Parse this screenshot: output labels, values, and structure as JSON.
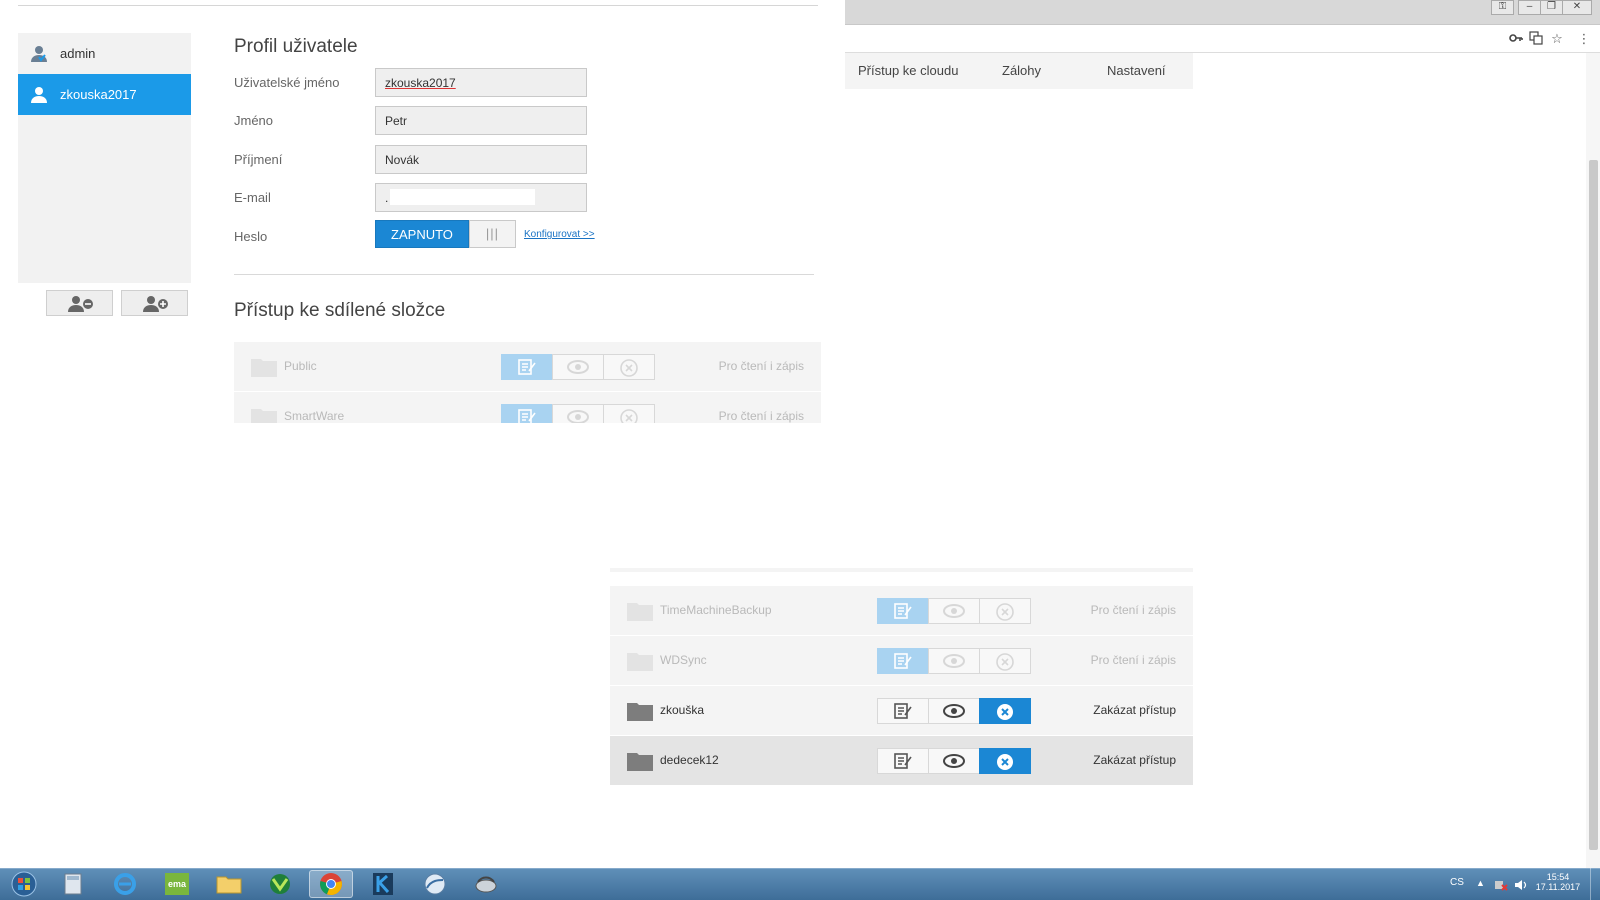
{
  "window": {
    "controls": [
      "lock",
      "minimize",
      "restore",
      "close"
    ]
  },
  "toolbar_icons": [
    "key-icon",
    "translate-icon",
    "star-icon",
    "menu-icon"
  ],
  "nav": {
    "tabs": [
      "Přístup ke cloudu",
      "Zálohy",
      "Nastavení"
    ]
  },
  "users": {
    "items": [
      {
        "name": "admin",
        "selected": false,
        "icon": "admin-user-icon"
      },
      {
        "name": "zkouska2017",
        "selected": true,
        "icon": "user-icon"
      }
    ],
    "remove_icon": "remove-user-icon",
    "add_icon": "add-user-icon"
  },
  "profile": {
    "title": "Profil uživatele",
    "username_label": "Uživatelské jméno",
    "username_value": "zkouska2017",
    "firstname_label": "Jméno",
    "firstname_value": "Petr",
    "lastname_label": "Příjmení",
    "lastname_value": "Novák",
    "email_label": "E-mail",
    "email_value": ".",
    "password_label": "Heslo",
    "password_toggle": "ZAPNUTO",
    "configure_link": "Konfigurovat >>"
  },
  "shares": {
    "title": "Přístup ke sdílené složce",
    "top_rows": [
      {
        "name": "Public",
        "status": "Pro čtení i zápis"
      },
      {
        "name": "SmartWare",
        "status": "Pro čtení i zápis"
      }
    ],
    "bottom_rows": [
      {
        "name": "TimeMachineBackup",
        "status": "Pro čtení i zápis",
        "faded": true
      },
      {
        "name": "WDSync",
        "status": "Pro čtení i zápis",
        "faded": true
      },
      {
        "name": "zkouška",
        "status": "Zakázat přístup",
        "faded": false
      },
      {
        "name": "dedecek12",
        "status": "Zakázat přístup",
        "faded": false
      }
    ]
  },
  "colors": {
    "accent": "#1b9ae8",
    "button_blue": "#1b87d4",
    "panel_bg": "#f2f2f2"
  },
  "taskbar": {
    "apps": [
      "start-orb-icon",
      "calculator-icon",
      "internet-explorer-icon",
      "ema-app-icon",
      "file-explorer-icon",
      "green-app-icon",
      "chrome-icon",
      "k-app-icon",
      "network-app-icon",
      "disk-app-icon"
    ],
    "ema_label": "ema",
    "lang": "CS",
    "time": "15:54",
    "date": "17.11.2017"
  }
}
